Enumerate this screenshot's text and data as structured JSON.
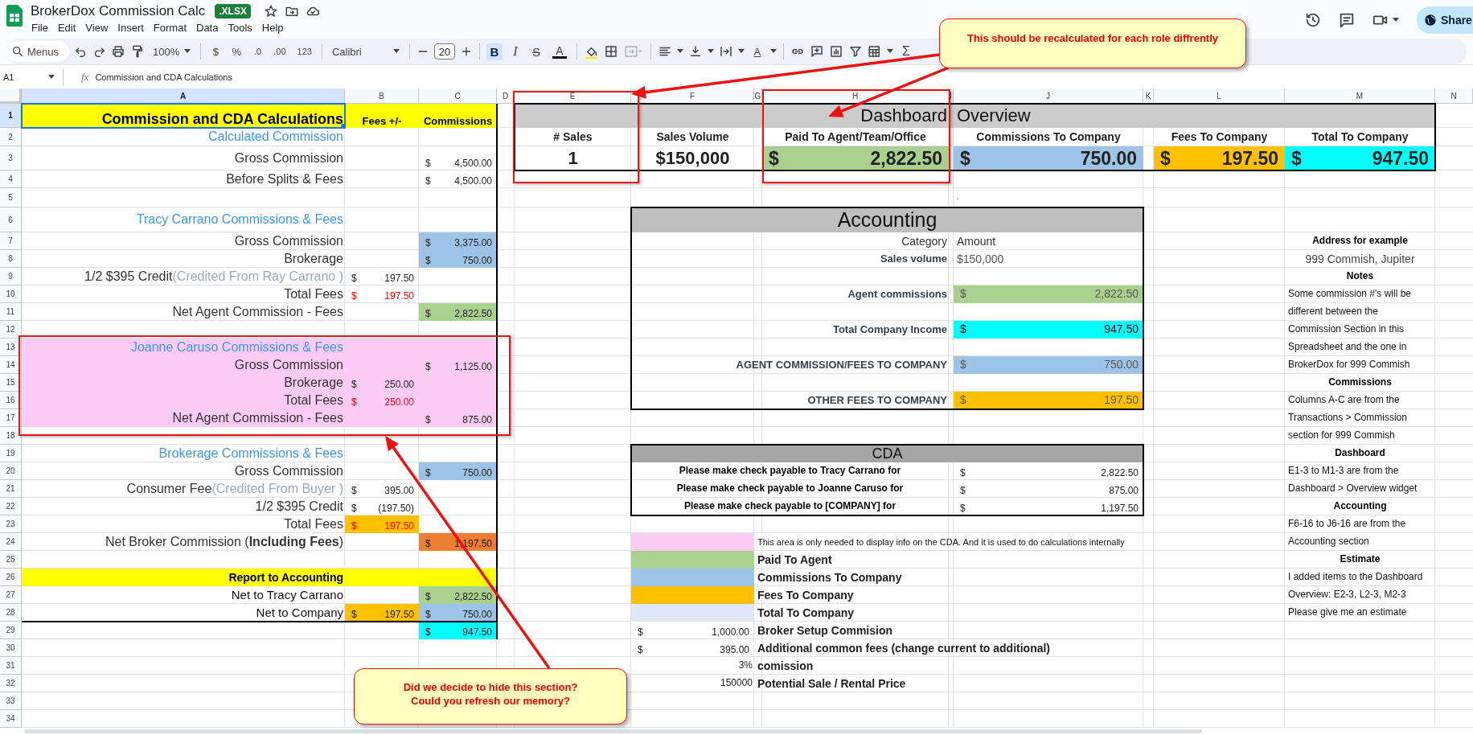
{
  "document": {
    "title": "BrokerDox Commission Calc",
    "badge": ".XLSX"
  },
  "menu": [
    "File",
    "Edit",
    "View",
    "Insert",
    "Format",
    "Data",
    "Tools",
    "Help"
  ],
  "share": {
    "label": "Share"
  },
  "toolbar": {
    "search": {
      "placeholder": "Menus"
    },
    "zoom": "100%",
    "number_formats": [
      "$",
      "%",
      ".0",
      ".00",
      "123"
    ],
    "font": "Calibri",
    "font_size": "20",
    "styles": [
      {
        "label": "B",
        "selected": true
      },
      {
        "label": "I",
        "selected": false
      },
      {
        "label": "S",
        "selected": false
      }
    ],
    "text_color_label": "A",
    "merge": {
      "disabled": true
    },
    "rotate_label": "A",
    "functions_label": "Σ"
  },
  "formula_bar": {
    "name_box": "A1",
    "symbol": "fx",
    "content": "Commission and CDA Calculations"
  },
  "sheet": {
    "column_headers": [
      {
        "label": "A",
        "selected": true
      },
      {
        "label": "B",
        "selected": false
      },
      {
        "label": "C",
        "selected": false
      },
      {
        "label": "D",
        "selected": false
      },
      {
        "label": "E",
        "selected": false
      },
      {
        "label": "F",
        "selected": false
      },
      {
        "label": "G",
        "selected": false
      },
      {
        "label": "H",
        "selected": false
      },
      {
        "label": "I",
        "selected": false
      },
      {
        "label": "J",
        "selected": false
      },
      {
        "label": "K",
        "selected": false
      },
      {
        "label": "L",
        "selected": false
      },
      {
        "label": "M",
        "selected": false
      },
      {
        "label": "N",
        "selected": false
      }
    ],
    "row_headers": [
      {
        "label": "1",
        "selected": true
      },
      {
        "label": "2",
        "selected": false
      },
      {
        "label": "3",
        "selected": false
      },
      {
        "label": "4",
        "selected": false
      },
      {
        "label": "5",
        "selected": false
      },
      {
        "label": "6",
        "selected": false
      },
      {
        "label": "7",
        "selected": false
      },
      {
        "label": "8",
        "selected": false
      },
      {
        "label": "9",
        "selected": false
      },
      {
        "label": "10",
        "selected": false
      },
      {
        "label": "11",
        "selected": false
      },
      {
        "label": "12",
        "selected": false
      },
      {
        "label": "13",
        "selected": false
      },
      {
        "label": "14",
        "selected": false
      },
      {
        "label": "15",
        "selected": false
      },
      {
        "label": "16",
        "selected": false
      },
      {
        "label": "17",
        "selected": false
      },
      {
        "label": "18",
        "selected": false
      },
      {
        "label": "19",
        "selected": false
      },
      {
        "label": "20",
        "selected": false
      },
      {
        "label": "21",
        "selected": false
      },
      {
        "label": "22",
        "selected": false
      },
      {
        "label": "23",
        "selected": false
      },
      {
        "label": "24",
        "selected": false
      },
      {
        "label": "25",
        "selected": false
      },
      {
        "label": "26",
        "selected": false
      },
      {
        "label": "27",
        "selected": false
      },
      {
        "label": "28",
        "selected": false
      },
      {
        "label": "29",
        "selected": false
      },
      {
        "label": "30",
        "selected": false
      },
      {
        "label": "31",
        "selected": false
      },
      {
        "label": "32",
        "selected": false
      },
      {
        "label": "33",
        "selected": false
      },
      {
        "label": "34",
        "selected": false
      }
    ],
    "fills": [
      {
        "color": "#ffff00"
      },
      {
        "color": "#ffff00"
      },
      {
        "color": "#fccbf6"
      },
      {
        "color": "#9dc3e6"
      },
      {
        "color": "#a9d08e"
      },
      {
        "color": "#9dc3e6"
      },
      {
        "color": "#ffc000"
      },
      {
        "color": "#ed7d31"
      },
      {
        "color": "#a9d08e"
      },
      {
        "color": "#ffc000"
      },
      {
        "color": "#9dc3e6"
      },
      {
        "color": "#00ffff"
      },
      {
        "color": "#cccccc"
      },
      {
        "color": "#a9d08e"
      },
      {
        "color": "#9dc3e6"
      },
      {
        "color": "#ffc000"
      },
      {
        "color": "#00ffff"
      },
      {
        "color": "#bfbfbf"
      },
      {
        "color": "#a9d08e"
      },
      {
        "color": "#00ffff"
      },
      {
        "color": "#9dc3e6"
      },
      {
        "color": "#ffc000"
      },
      {
        "color": "#a6a6a6"
      },
      {
        "color": "#fccbf6"
      },
      {
        "color": "#a9d08e"
      },
      {
        "color": "#9dc3e6"
      },
      {
        "color": "#ffc000"
      },
      {
        "color": "#dde8f4"
      }
    ],
    "cells": [
      {
        "kind": "title",
        "text": "Commission and CDA Calculations"
      },
      {
        "kind": "colhead",
        "text": "Fees +/-"
      },
      {
        "kind": "colhead",
        "text": "Commissions"
      },
      {
        "kind": "heading",
        "text": "Calculated Commission"
      },
      {
        "kind": "label",
        "text": "Gross Commission"
      },
      {
        "kind": "money",
        "symbol": "$",
        "value": "4,500.00"
      },
      {
        "kind": "label",
        "text": "Before Splits & Fees"
      },
      {
        "kind": "money",
        "symbol": "$",
        "value": "4,500.00"
      },
      {
        "kind": "heading",
        "text": "Tracy Carrano Commissions & Fees"
      },
      {
        "kind": "label",
        "text": "Gross Commission"
      },
      {
        "kind": "money",
        "symbol": "$",
        "value": "3,375.00"
      },
      {
        "kind": "label",
        "text": "Brokerage"
      },
      {
        "kind": "money",
        "symbol": "$",
        "value": "750.00"
      },
      {
        "kind": "label",
        "text": "1/2 $395 Credit",
        "note": "(Credited From Ray Carrano )"
      },
      {
        "kind": "money",
        "symbol": "$",
        "value": "197.50"
      },
      {
        "kind": "label",
        "text": "Total Fees"
      },
      {
        "kind": "money-red",
        "symbol": "$",
        "value": "197.50"
      },
      {
        "kind": "label",
        "text": "Net Agent Commission - Fees"
      },
      {
        "kind": "money",
        "symbol": "$",
        "value": "2,822.50"
      },
      {
        "kind": "heading",
        "text": "Joanne Caruso Commissions & Fees"
      },
      {
        "kind": "label",
        "text": "Gross Commission"
      },
      {
        "kind": "money",
        "symbol": "$",
        "value": "1,125.00"
      },
      {
        "kind": "label",
        "text": "Brokerage"
      },
      {
        "kind": "money",
        "symbol": "$",
        "value": "250.00"
      },
      {
        "kind": "label",
        "text": "Total Fees"
      },
      {
        "kind": "money-red",
        "symbol": "$",
        "value": "250.00"
      },
      {
        "kind": "label",
        "text": "Net Agent Commission - Fees"
      },
      {
        "kind": "money",
        "symbol": "$",
        "value": "875.00"
      },
      {
        "kind": "heading",
        "text": "Brokerage Commissions & Fees"
      },
      {
        "kind": "label",
        "text": "Gross Commission"
      },
      {
        "kind": "money",
        "symbol": "$",
        "value": "750.00"
      },
      {
        "kind": "label",
        "text": "Consumer Fee",
        "note": "(Credited From Buyer )"
      },
      {
        "kind": "money",
        "symbol": "$",
        "value": "395.00"
      },
      {
        "kind": "label",
        "text": "1/2 $395 Credit"
      },
      {
        "kind": "money",
        "symbol": "$",
        "value": "(197.50)"
      },
      {
        "kind": "label",
        "text": "Total Fees"
      },
      {
        "kind": "money-red",
        "symbol": "$",
        "value": "197.50"
      },
      {
        "kind": "label",
        "text": "Net Broker Commission (**Including Fees**)"
      },
      {
        "kind": "money",
        "symbol": "$",
        "value": "1,197.50"
      },
      {
        "kind": "section",
        "text": "Report to Accounting"
      },
      {
        "kind": "label-cal",
        "text": "Net to Tracy Carrano"
      },
      {
        "kind": "money",
        "symbol": "$",
        "value": "2,822.50"
      },
      {
        "kind": "label-cal",
        "text": "Net to Company"
      },
      {
        "kind": "money",
        "symbol": "$",
        "value": "197.50"
      },
      {
        "kind": "money",
        "symbol": "$",
        "value": "750.00"
      },
      {
        "kind": "money",
        "symbol": "$",
        "value": "947.50"
      },
      {
        "kind": "banner-right",
        "text": "Dashboard"
      },
      {
        "kind": "banner-left",
        "text": "Overview"
      },
      {
        "kind": "dash-label",
        "text": "# Sales"
      },
      {
        "kind": "dash-label",
        "text": "Sales Volume"
      },
      {
        "kind": "dash-label",
        "text": "Paid To Agent/Team/Office"
      },
      {
        "kind": "dash-label",
        "text": "Commissions To Company"
      },
      {
        "kind": "dash-label",
        "text": "Fees To Company"
      },
      {
        "kind": "dash-label",
        "text": "Total To Company"
      },
      {
        "kind": "dash-value",
        "text": "1"
      },
      {
        "kind": "dash-value",
        "text": "$150,000"
      },
      {
        "kind": "dash-money",
        "symbol": "$",
        "value": "2,822.50"
      },
      {
        "kind": "dash-money",
        "symbol": "$",
        "value": "750.00"
      },
      {
        "kind": "dash-money",
        "symbol": "$",
        "value": "197.50"
      },
      {
        "kind": "dash-money",
        "symbol": "$",
        "value": "947.50"
      },
      {
        "kind": "mark",
        "text": "`"
      },
      {
        "kind": "acct-title",
        "text": "Accounting"
      },
      {
        "kind": "acct-head-right",
        "text": "Category"
      },
      {
        "kind": "acct-head-left",
        "text": "Amount"
      },
      {
        "kind": "acct-label",
        "text": "Sales volume"
      },
      {
        "kind": "text-left",
        "text": "$150,000"
      },
      {
        "kind": "acct-label",
        "text": "Agent commissions"
      },
      {
        "kind": "acct-money",
        "symbol": "$",
        "value": "2,822.50"
      },
      {
        "kind": "acct-label",
        "text": "Total Company Income"
      },
      {
        "kind": "acct-money-strong",
        "symbol": "$",
        "value": "947.50"
      },
      {
        "kind": "acct-label",
        "text": "AGENT COMMISSION/FEES TO COMPANY"
      },
      {
        "kind": "acct-money",
        "symbol": "$",
        "value": "750.00"
      },
      {
        "kind": "acct-label",
        "text": "OTHER FEES TO COMPANY"
      },
      {
        "kind": "acct-money",
        "symbol": "$",
        "value": "197.50"
      },
      {
        "kind": "cda-title",
        "text": "CDA"
      },
      {
        "kind": "cda-text",
        "text": "Please make check payable to Tracy Carrano for"
      },
      {
        "kind": "money",
        "symbol": "$",
        "value": "2,822.50"
      },
      {
        "kind": "cda-text",
        "text": "Please make check payable to Joanne Caruso for"
      },
      {
        "kind": "money",
        "symbol": "$",
        "value": "875.00"
      },
      {
        "kind": "cda-text",
        "text": "Please make check payable to [COMPANY] for"
      },
      {
        "kind": "money",
        "symbol": "$",
        "value": "1,197.50"
      },
      {
        "kind": "note-small",
        "text": "This area is only needed to display info on the CDA. And it is used to do calculations internally"
      },
      {
        "kind": "legend",
        "text": "Paid To Agent"
      },
      {
        "kind": "legend",
        "text": "Commissions To Company"
      },
      {
        "kind": "legend",
        "text": "Fees To Company"
      },
      {
        "kind": "legend",
        "text": "Total To Company"
      },
      {
        "kind": "money",
        "symbol": "$",
        "value": "1,000.00"
      },
      {
        "kind": "legend",
        "text": "Broker Setup Commision"
      },
      {
        "kind": "money",
        "symbol": "$",
        "value": "395.00"
      },
      {
        "kind": "legend",
        "text": "Additional common fees (change current to additional)"
      },
      {
        "kind": "num-right",
        "text": "3%"
      },
      {
        "kind": "legend",
        "text": "comission"
      },
      {
        "kind": "num-right",
        "text": "150000"
      },
      {
        "kind": "legend",
        "text": "Potential Sale / Rental Price"
      },
      {
        "kind": "note-title",
        "text": "Address for example"
      },
      {
        "kind": "note-center",
        "text": "999 Commish, Jupiter"
      },
      {
        "kind": "note-title",
        "text": "Notes"
      },
      {
        "kind": "note-text",
        "text": "Some commission #'s will be"
      },
      {
        "kind": "note-text",
        "text": "different between the"
      },
      {
        "kind": "note-text",
        "text": "Commission Section in this"
      },
      {
        "kind": "note-text",
        "text": "Spreadsheet and the one in"
      },
      {
        "kind": "note-text",
        "text": "BrokerDox for 999 Commish"
      },
      {
        "kind": "note-title",
        "text": "Commissions"
      },
      {
        "kind": "note-text",
        "text": "Columns A-C are from the"
      },
      {
        "kind": "note-text",
        "text": "Transactions > Commission"
      },
      {
        "kind": "note-text",
        "text": "section for 999 Commish"
      },
      {
        "kind": "note-title",
        "text": "Dashboard"
      },
      {
        "kind": "note-text",
        "text": "E1-3 to M1-3 are from the"
      },
      {
        "kind": "note-text",
        "text": "Dashboard > Overview widget"
      },
      {
        "kind": "note-title",
        "text": "Accounting"
      },
      {
        "kind": "note-text",
        "text": "F6-16 to J6-16 are from the"
      },
      {
        "kind": "note-text",
        "text": "Accounting section"
      },
      {
        "kind": "note-title",
        "text": "Estimate"
      },
      {
        "kind": "note-text",
        "text": "I added items to the Dashboard"
      },
      {
        "kind": "note-text",
        "text": "Overview: E2-3, L2-3, M2-3"
      },
      {
        "kind": "note-text",
        "text": "Please give me an estimate"
      }
    ]
  },
  "callouts": [
    {
      "lines": [
        "This should be recalculated for each role diffrently"
      ]
    },
    {
      "lines": [
        "Did we decide to hide this section?",
        "Could you refresh our memory?"
      ]
    }
  ]
}
